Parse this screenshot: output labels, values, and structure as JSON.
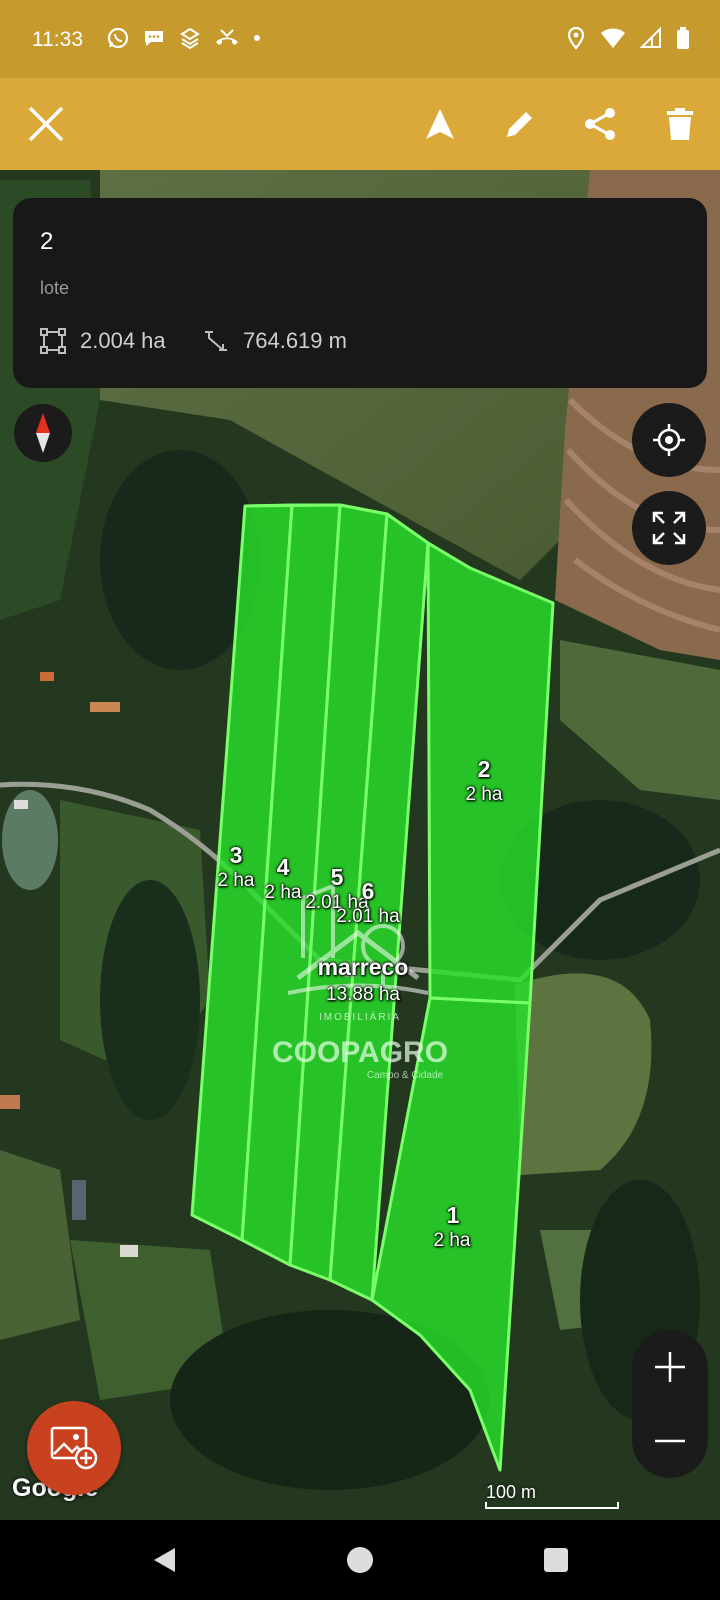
{
  "status_bar": {
    "time": "11:33",
    "left_icons": [
      "whatsapp-icon",
      "chat-bubble-icon",
      "app-icon",
      "missed-call-icon",
      "dot-icon"
    ],
    "right_icons": [
      "location-icon",
      "wifi-icon",
      "signal-icon",
      "battery-icon"
    ]
  },
  "toolbar": {
    "buttons": [
      "close-icon",
      "navigate-icon",
      "edit-icon",
      "share-icon",
      "delete-icon"
    ],
    "bg_color": "#dba939"
  },
  "info_card": {
    "title": "2",
    "subtitle": "lote",
    "area": "2.004 ha",
    "perimeter": "764.619 m"
  },
  "map": {
    "polygon_color": "#27e02a",
    "watermark": {
      "top": "IMOBILIÁRIA",
      "brand": "COOPAGRO",
      "tagline": "Campo & Cidade"
    },
    "parcels": [
      {
        "name": "3",
        "area": "2 ha"
      },
      {
        "name": "4",
        "area": "2 ha"
      },
      {
        "name": "5",
        "area": "2.01 ha"
      },
      {
        "name": "6",
        "area": "2.01 ha"
      },
      {
        "name": "2",
        "area": "2 ha"
      },
      {
        "name": "1",
        "area": "2 ha"
      }
    ],
    "group": {
      "name": "marreco",
      "area": "13.88 ha"
    },
    "attribution": "Google",
    "scale_label": "100 m"
  }
}
